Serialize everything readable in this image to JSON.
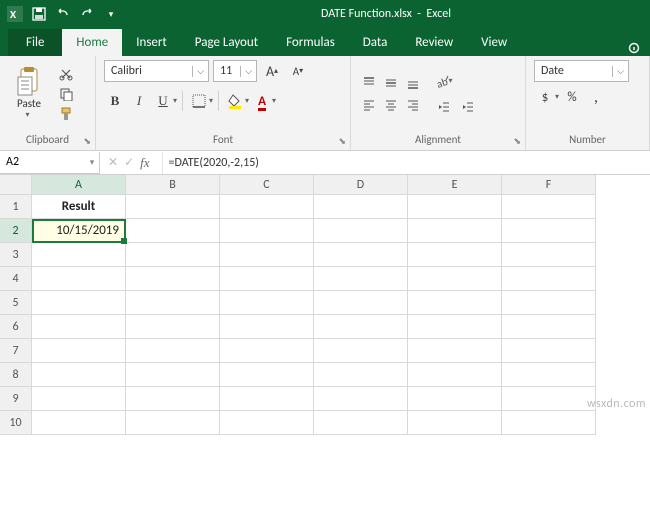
{
  "titlebar": {
    "filename": "DATE Function.xlsx",
    "appname": "Excel"
  },
  "tabs": {
    "file": "File",
    "home": "Home",
    "insert": "Insert",
    "page_layout": "Page Layout",
    "formulas": "Formulas",
    "data": "Data",
    "review": "Review",
    "view": "View"
  },
  "clipboard": {
    "paste": "Paste",
    "group": "Clipboard"
  },
  "font": {
    "name": "Calibri",
    "size": "11",
    "group": "Font",
    "bold": "B",
    "italic": "I",
    "underline": "U",
    "incA": "A",
    "decA": "A"
  },
  "alignment": {
    "group": "Alignment"
  },
  "number": {
    "group": "Number",
    "format": "Date",
    "dollar": "$",
    "percent": "%",
    "comma": ","
  },
  "namebox": {
    "value": "A2"
  },
  "formula": {
    "value": "=DATE(2020,-2,15)"
  },
  "columns": [
    "A",
    "B",
    "C",
    "D",
    "E",
    "F"
  ],
  "rows": [
    "1",
    "2",
    "3",
    "4",
    "5",
    "6",
    "7",
    "8",
    "9",
    "10"
  ],
  "cells": {
    "A1": "Result",
    "A2": "10/15/2019"
  },
  "watermark": "wsxdn.com"
}
